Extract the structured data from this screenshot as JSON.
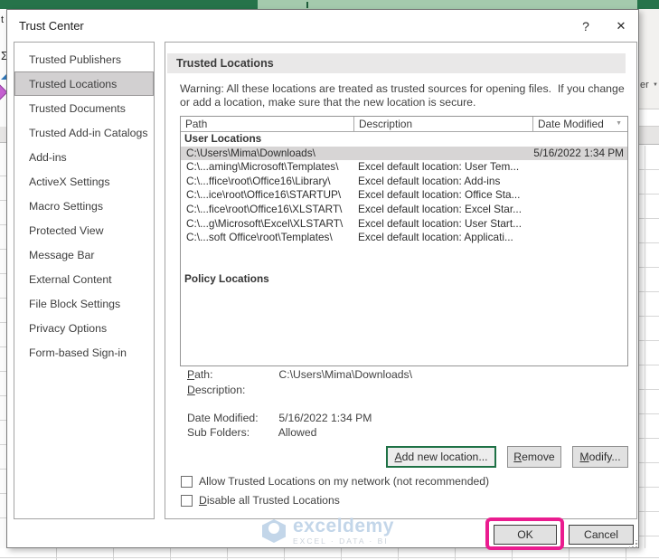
{
  "window": {
    "title": "Trust Center",
    "help_glyph": "?",
    "close_glyph": "✕"
  },
  "background": {
    "ribbon_fragment": "er",
    "left_fragments": {
      "t": "t",
      "sigma": "Σ"
    }
  },
  "sidebar": {
    "selected_index": 1,
    "items": [
      "Trusted Publishers",
      "Trusted Locations",
      "Trusted Documents",
      "Trusted Add-in Catalogs",
      "Add-ins",
      "ActiveX Settings",
      "Macro Settings",
      "Protected View",
      "Message Bar",
      "External Content",
      "File Block Settings",
      "Privacy Options",
      "Form-based Sign-in"
    ]
  },
  "main": {
    "section_title": "Trusted Locations",
    "warning": "Warning: All these locations are treated as trusted sources for opening files.  If you change or add a location, make sure that the new location is secure.",
    "table": {
      "columns": [
        "Path",
        "Description",
        "Date Modified"
      ],
      "sort_glyph": "▼",
      "group_user": "User Locations",
      "group_policy": "Policy Locations",
      "rows": [
        {
          "path": "C:\\Users\\Mima\\Downloads\\",
          "description": "",
          "date_modified": "5/16/2022 1:34 PM"
        },
        {
          "path": "C:\\...aming\\Microsoft\\Templates\\",
          "description": "Excel default location: User Tem..."
        },
        {
          "path": "C:\\...ffice\\root\\Office16\\Library\\",
          "description": "Excel default location: Add-ins"
        },
        {
          "path": "C:\\...ice\\root\\Office16\\STARTUP\\",
          "description": "Excel default location: Office Sta..."
        },
        {
          "path": "C:\\...fice\\root\\Office16\\XLSTART\\",
          "description": "Excel default location: Excel Star..."
        },
        {
          "path": "C:\\...g\\Microsoft\\Excel\\XLSTART\\",
          "description": "Excel default location: User Start..."
        },
        {
          "path": "C:\\...soft Office\\root\\Templates\\",
          "description": "Excel default location: Applicati..."
        }
      ]
    },
    "details": {
      "path_label": "Path:",
      "path_value": "C:\\Users\\Mima\\Downloads\\",
      "description_label": "Description:",
      "description_value": "",
      "date_modified_label": "Date Modified:",
      "date_modified_value": "5/16/2022 1:34 PM",
      "sub_folders_label": "Sub Folders:",
      "sub_folders_value": "Allowed"
    },
    "buttons": {
      "add": "Add new location...",
      "remove": "Remove",
      "modify": "Modify..."
    },
    "checkboxes": [
      {
        "label": "Allow Trusted Locations on my network (not recommended)",
        "checked": false
      },
      {
        "label": "Disable all Trusted Locations",
        "checked": false
      }
    ]
  },
  "footer": {
    "ok": "OK",
    "cancel": "Cancel"
  },
  "watermark": {
    "brand": "exceldemy",
    "tagline": "EXCEL · DATA · BI"
  },
  "colors": {
    "excel_green": "#26734a",
    "search_green": "#a4caad",
    "annotation_magenta": "#ea1c8f",
    "add_button_green": "#1e7145",
    "selection_gray": "#d2d0d1",
    "watermark_blue": "#b9cfe6"
  }
}
